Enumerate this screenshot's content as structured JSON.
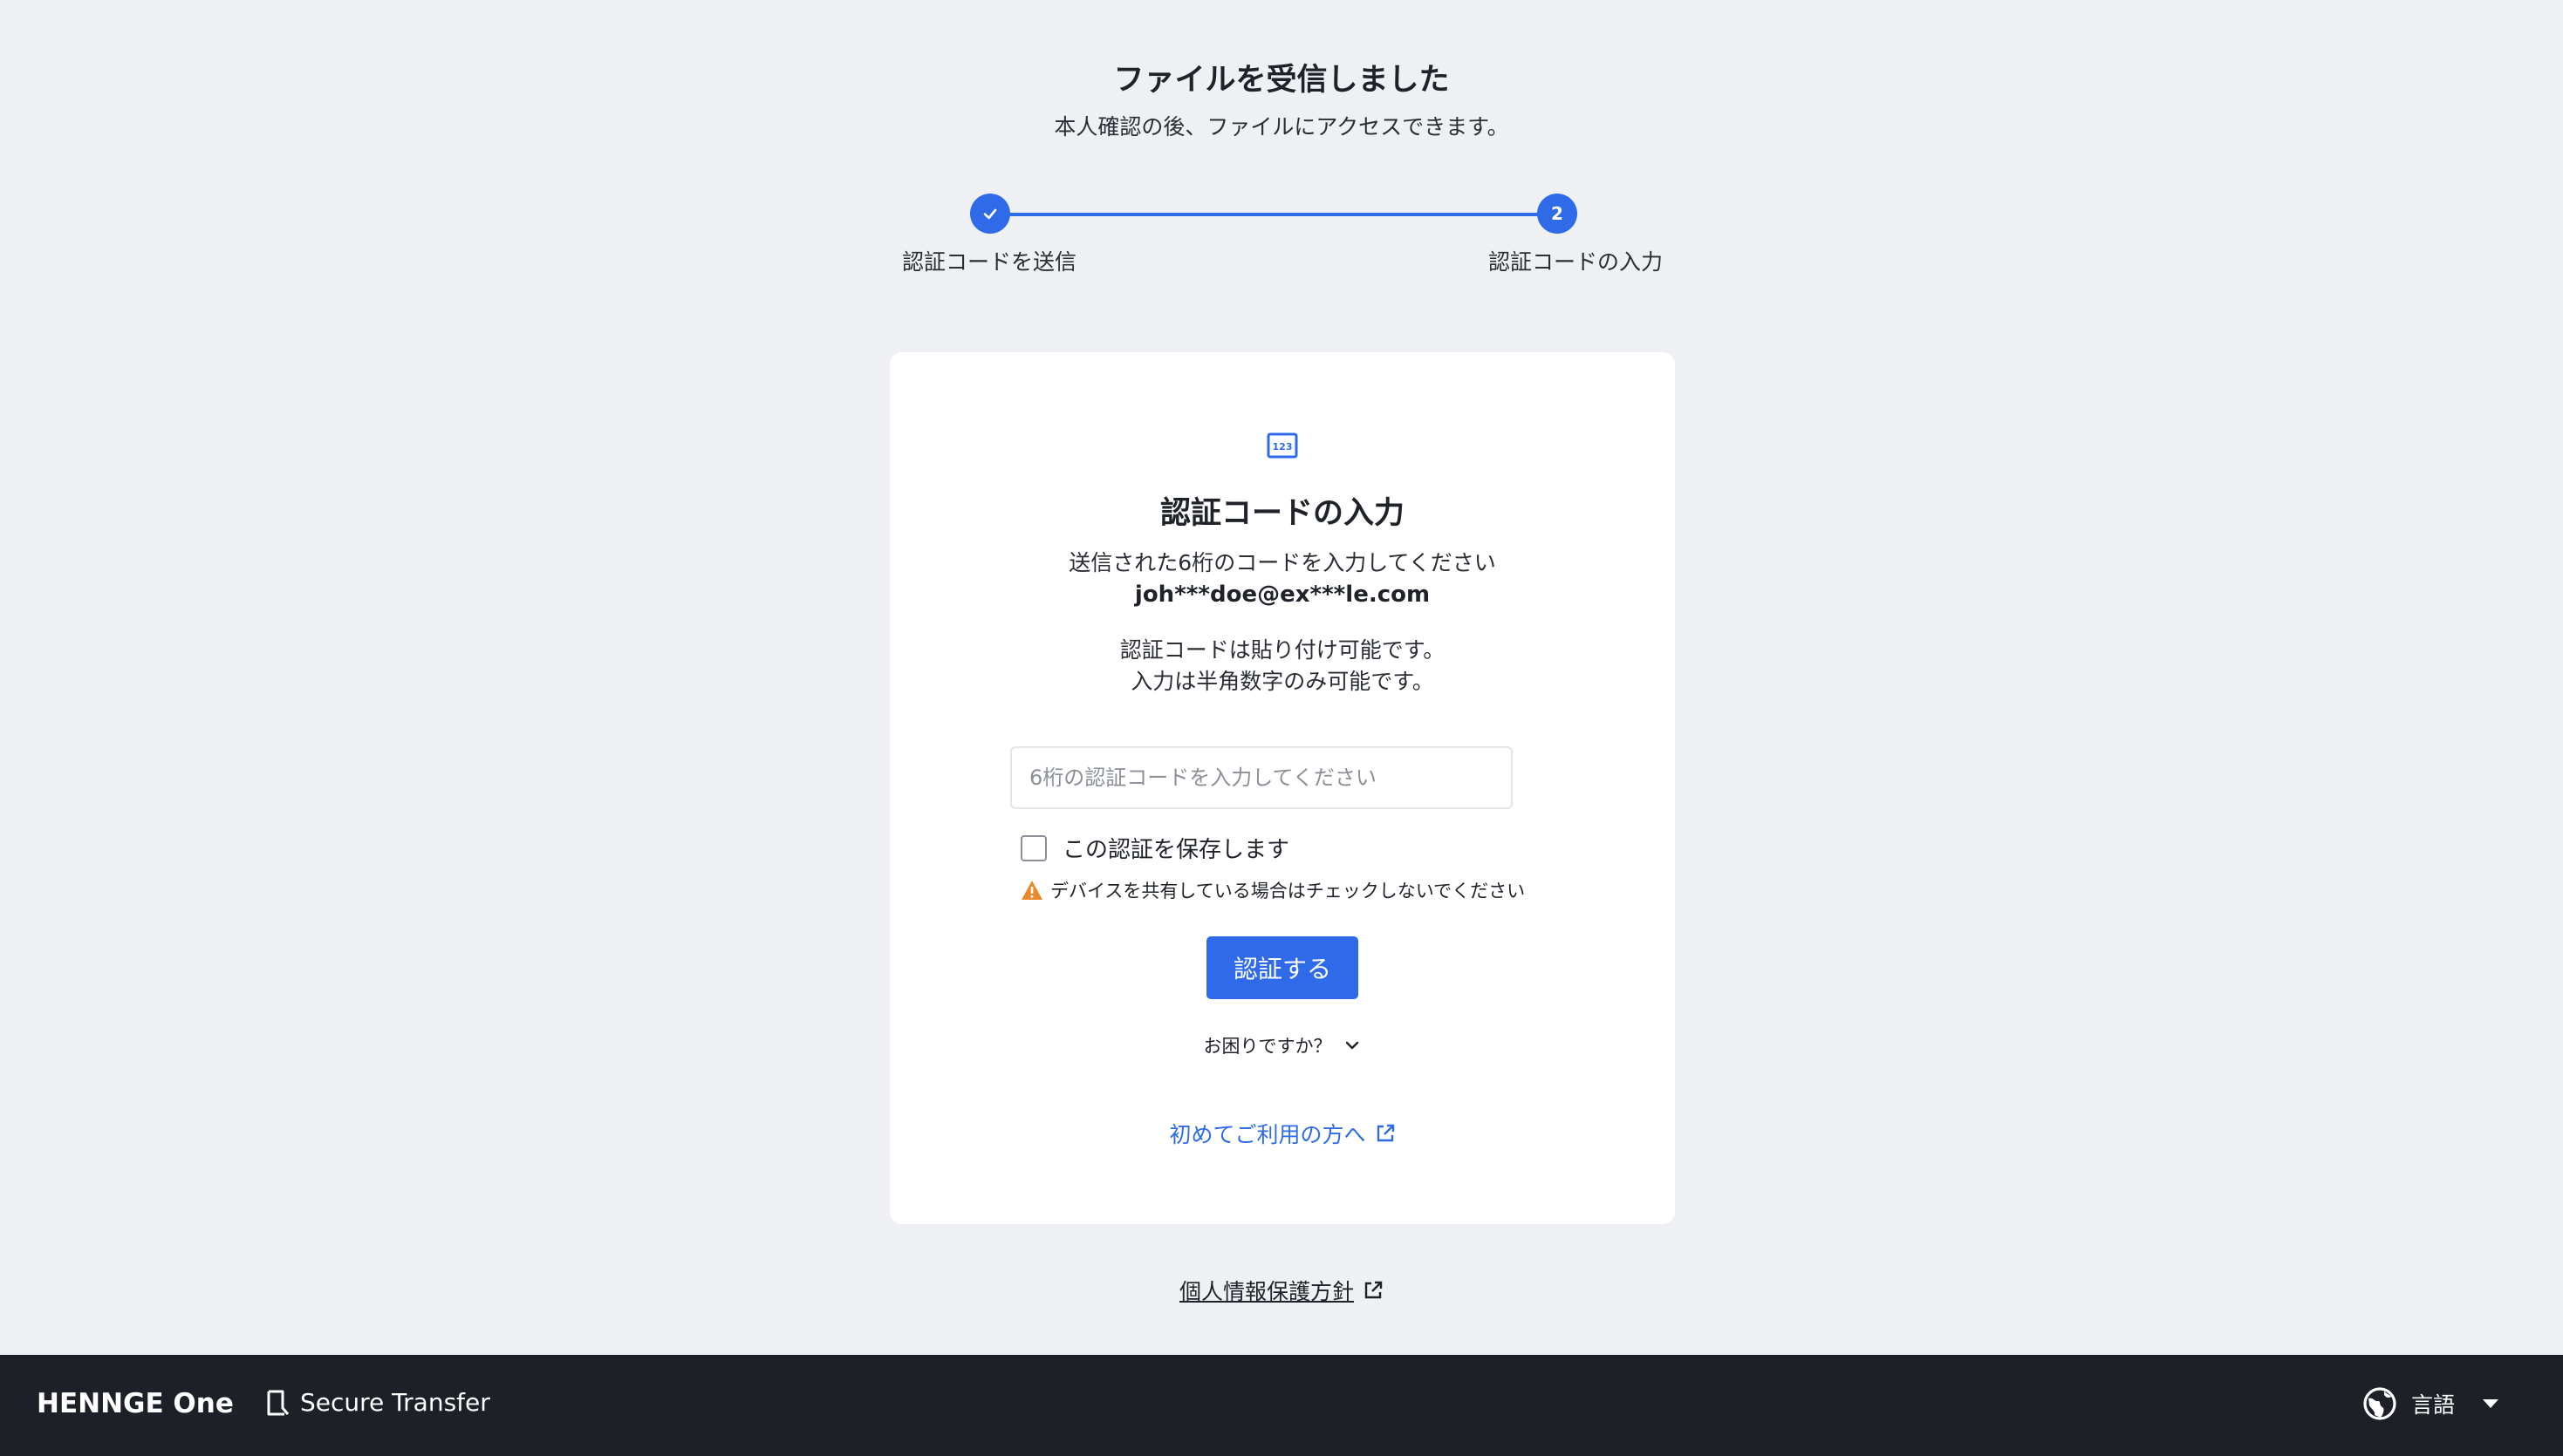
{
  "header": {
    "title": "ファイルを受信しました",
    "subtitle": "本人確認の後、ファイルにアクセスできます。"
  },
  "stepper": {
    "steps": [
      {
        "label": "認証コードを送信",
        "state": "done",
        "icon": "check-icon"
      },
      {
        "label": "認証コードの入力",
        "state": "current",
        "number": "2"
      }
    ],
    "accent_color": "#2f6be8"
  },
  "card": {
    "icon": "numeric-code-icon",
    "title": "認証コードの入力",
    "description": "送信された6桁のコードを入力してください",
    "email": "joh***doe@ex***le.com",
    "note_line1": "認証コードは貼り付け可能です。",
    "note_line2": "入力は半角数字のみ可能です。",
    "code_input": {
      "placeholder": "6桁の認証コードを入力してください",
      "value": ""
    },
    "remember_label": "この認証を保存します",
    "remember_checked": false,
    "warning_text": "デバイスを共有している場合はチェックしないでください",
    "warning_color": "#e8892e",
    "verify_button": "認証する",
    "help_label": "お困りですか？",
    "first_time_link": "初めてご利用の方へ"
  },
  "privacy_link": "個人情報保護方針",
  "footer": {
    "logo": "HENNGE One",
    "product": "Secure Transfer",
    "language_label": "言語"
  }
}
